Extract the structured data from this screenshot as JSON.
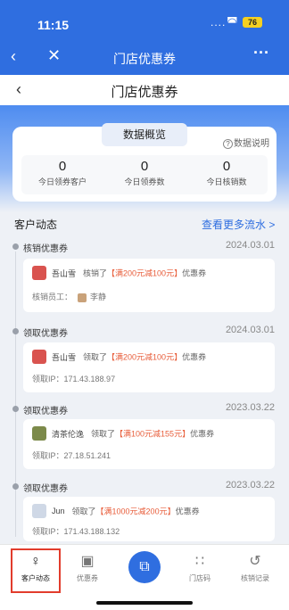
{
  "status": {
    "time": "11:15",
    "battery": "76"
  },
  "nav1": {
    "back_icon": "chevron-left",
    "close_icon": "close",
    "title": "门店优惠券",
    "more_icon": "more-dots"
  },
  "nav2": {
    "back_icon": "chevron-left",
    "title": "门店优惠券"
  },
  "overview": {
    "tab_label": "数据概览",
    "help_label": "数据说明",
    "stats": [
      {
        "value": "0",
        "label": "今日领券客户"
      },
      {
        "value": "0",
        "label": "今日领券数"
      },
      {
        "value": "0",
        "label": "今日核销数"
      }
    ]
  },
  "activity": {
    "title": "客户动态",
    "more_link": "查看更多流水 >",
    "events": [
      {
        "type": "核销优惠券",
        "date": "2024.03.01",
        "customer": "吾山雪",
        "action": "核销了",
        "coupon": "【满200元减100元】",
        "suffix": "优惠券",
        "detail_label": "核销员工：",
        "detail_value": "李静",
        "avatar_color": "#d9534f"
      },
      {
        "type": "领取优惠券",
        "date": "2024.03.01",
        "customer": "吾山雪",
        "action": "领取了",
        "coupon": "【满200元减100元】",
        "suffix": "优惠券",
        "detail_label": "领取IP：",
        "detail_value": "171.43.188.97",
        "avatar_color": "#d9534f"
      },
      {
        "type": "领取优惠券",
        "date": "2023.03.22",
        "customer": "清茶伦逸",
        "action": "领取了",
        "coupon": "【满100元减155元】",
        "suffix": "优惠券",
        "detail_label": "领取IP：",
        "detail_value": "27.18.51.241",
        "avatar_color": "#7c8a4a"
      },
      {
        "type": "领取优惠券",
        "date": "2023.03.22",
        "customer": "Jun",
        "action": "领取了",
        "coupon": "【满1000元减200元】",
        "suffix": "优惠券",
        "detail_label": "领取IP：",
        "detail_value": "171.43.188.132",
        "avatar_color": "#cfd8e6"
      }
    ]
  },
  "tabbar": {
    "items": [
      {
        "label": "客户动态",
        "icon": "customer-activity"
      },
      {
        "label": "优惠券",
        "icon": "coupon"
      },
      {
        "label": "",
        "icon": "scan"
      },
      {
        "label": "门店码",
        "icon": "qr-code"
      },
      {
        "label": "核销记录",
        "icon": "history"
      }
    ]
  }
}
